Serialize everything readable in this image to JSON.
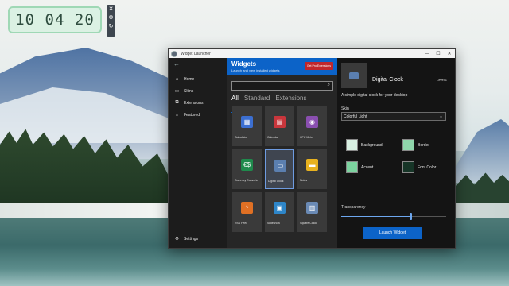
{
  "desktop": {
    "clock": {
      "hours": "10",
      "minutes": "04",
      "seconds": "20"
    },
    "clock_controls": [
      "close-icon",
      "gear-icon",
      "refresh-icon"
    ]
  },
  "window": {
    "title": "Widget Launcher",
    "controls": {
      "minimize": "—",
      "maximize": "☐",
      "close": "✕"
    }
  },
  "nav": {
    "back": "←",
    "items": [
      {
        "label": "Home",
        "icon": "home-icon",
        "glyph": "⌂"
      },
      {
        "label": "Skins",
        "icon": "skins-icon",
        "glyph": "▭"
      },
      {
        "label": "Extensions",
        "icon": "extensions-icon",
        "glyph": "⧉"
      },
      {
        "label": "Featured",
        "icon": "star-icon",
        "glyph": "☆"
      }
    ],
    "settings": {
      "label": "Settings",
      "icon": "gear-icon",
      "glyph": "⚙"
    }
  },
  "widgets_panel": {
    "title": "Widgets",
    "subtitle": "Launch and view installed widgets",
    "pro_button": "Get Pro Extensions",
    "search_placeholder": "",
    "tabs": [
      "All",
      "Standard",
      "Extensions"
    ],
    "active_tab": "All",
    "tiles": [
      {
        "label": "Calculator",
        "icon": "calculator-icon",
        "glyph": "▦",
        "color": "#3c6fd1"
      },
      {
        "label": "Calendar",
        "icon": "calendar-icon",
        "glyph": "▤",
        "color": "#c9363c"
      },
      {
        "label": "CPU Meter",
        "icon": "cpu-meter-icon",
        "glyph": "◉",
        "color": "#8a4fb0"
      },
      {
        "label": "Currency Converter",
        "icon": "currency-icon",
        "glyph": "€$",
        "color": "#1f8a4c"
      },
      {
        "label": "Digital Clock",
        "icon": "digital-clock-icon",
        "glyph": "▭",
        "color": "#5b7fb0"
      },
      {
        "label": "Notes",
        "icon": "notes-icon",
        "glyph": "▬",
        "color": "#e8b21f"
      },
      {
        "label": "RSS Feed",
        "icon": "rss-icon",
        "glyph": "◝",
        "color": "#e07024"
      },
      {
        "label": "Slideshow",
        "icon": "slideshow-icon",
        "glyph": "▣",
        "color": "#2e86c9"
      },
      {
        "label": "Square Clock",
        "icon": "square-clock-icon",
        "glyph": "▥",
        "color": "#6a8ab5"
      }
    ],
    "selected_tile": "Digital Clock"
  },
  "detail": {
    "name": "Digital Clock",
    "level": "Level 1",
    "description": "A simple digital clock for your desktop",
    "skin_label": "Skin",
    "skin_value": "Colorful Light",
    "colors": [
      {
        "label": "Background",
        "value": "#d8f0e2"
      },
      {
        "label": "Border",
        "value": "#8fd6ab"
      },
      {
        "label": "Accent",
        "value": "#7cd39f"
      },
      {
        "label": "Font Color",
        "value": "#163527"
      }
    ],
    "transparency_label": "Transparency",
    "transparency": 0.66,
    "launch_button": "Launch Widget"
  },
  "theme": {
    "accent": "#0c63c8",
    "danger": "#c0262b"
  }
}
